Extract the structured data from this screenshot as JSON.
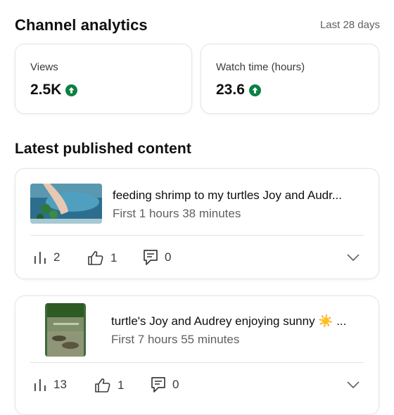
{
  "header": {
    "title": "Channel analytics",
    "period": "Last 28 days"
  },
  "stats": [
    {
      "label": "Views",
      "value": "2.5K",
      "trend": "up"
    },
    {
      "label": "Watch time (hours)",
      "value": "23.6",
      "trend": "up"
    }
  ],
  "latest": {
    "title": "Latest published content",
    "videos": [
      {
        "title": "feeding shrimp to my turtles Joy and Audr...",
        "subtitle": "First 1 hours 38 minutes",
        "views": "2",
        "likes": "1",
        "comments": "0"
      },
      {
        "title": "turtle's Joy and Audrey enjoying sunny ☀️ ...",
        "subtitle": "First 7 hours 55 minutes",
        "views": "13",
        "likes": "1",
        "comments": "0"
      }
    ]
  },
  "colors": {
    "trend_up": "#0b8043",
    "text_secondary": "#606060"
  }
}
